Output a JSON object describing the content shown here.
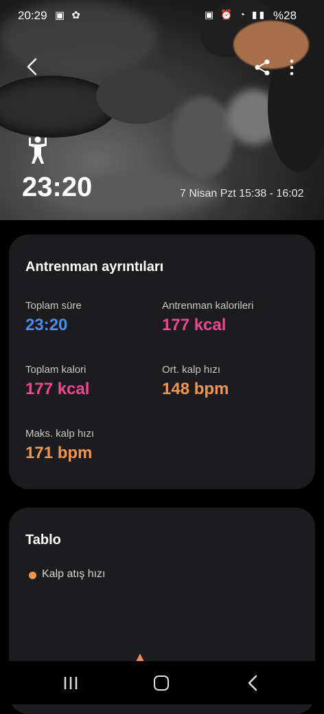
{
  "status_bar": {
    "time": "20:29",
    "left_icons": "▣ ✿",
    "right_icons": "▣ ⏰ ◔ ▮▮",
    "battery": "%28"
  },
  "hero": {
    "duration": "23:20",
    "date_range": "7 Nisan Pzt 15:38 - 16:02",
    "workout_icon": "weightlifter-icon"
  },
  "details": {
    "title": "Antrenman ayrıntıları",
    "total_duration": {
      "label": "Toplam süre",
      "value": "23:20"
    },
    "workout_calories": {
      "label": "Antrenman kalorileri",
      "value": "177 kcal"
    },
    "total_calories": {
      "label": "Toplam kalori",
      "value": "177 kcal"
    },
    "avg_heart_rate": {
      "label": "Ort. kalp hızı",
      "value": "148 bpm"
    },
    "max_heart_rate": {
      "label": "Maks. kalp hızı",
      "value": "171 bpm"
    }
  },
  "chart": {
    "title": "Tablo",
    "legend": "Kalp atış hızı"
  },
  "colors": {
    "blue": "#4a8df0",
    "pink": "#f0478f",
    "orange": "#f0964f",
    "card": "#1c1c1e"
  }
}
